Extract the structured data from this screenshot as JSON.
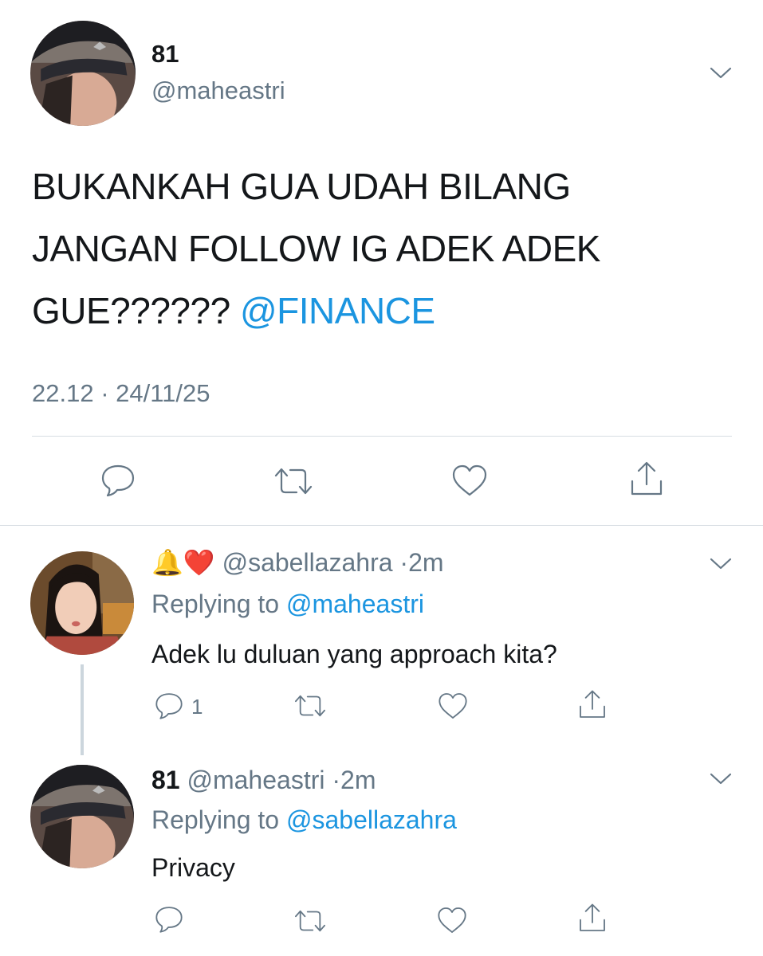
{
  "main_tweet": {
    "name": "81",
    "handle": "@maheastri",
    "text_plain": "BUKANKAH GUA UDAH BILANG JANGAN FOLLOW IG ADEK ADEK GUE??????",
    "text_mention": "@FINANCE",
    "timestamp": "22.12 · 24/11/25",
    "actions": [
      "reply-icon",
      "retweet-icon",
      "like-icon",
      "share-icon"
    ]
  },
  "replies": [
    {
      "emojis": "🔔❤️",
      "handle": "@sabellazahra",
      "separator": "·",
      "age": "2m",
      "replying_prefix": "Replying to",
      "replying_to": "@maheastri",
      "text": "Adek lu duluan yang approach kita?",
      "reply_count": "1"
    },
    {
      "name": "81",
      "handle": "@maheastri",
      "separator": "·",
      "age": "2m",
      "replying_prefix": "Replying to",
      "replying_to": "@sabellazahra",
      "text": "Privacy",
      "reply_count": ""
    }
  ],
  "colors": {
    "text": "#14171a",
    "muted": "#657786",
    "link": "#1b95e0",
    "divider": "#d7dde2"
  }
}
